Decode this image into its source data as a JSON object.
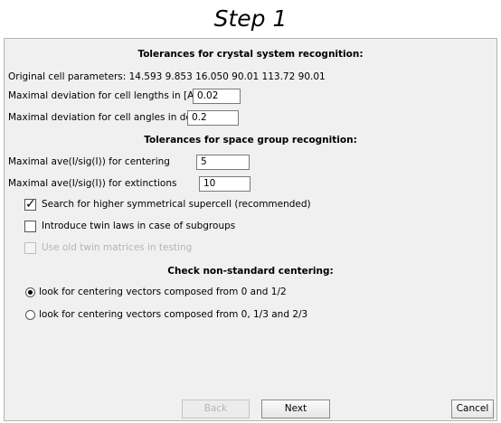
{
  "step_title": "Step 1",
  "crystal": {
    "header": "Tolerances for crystal system recognition:",
    "original_cell_label": "Original cell parameters: 14.593 9.853 16.050 90.01 113.72 90.01",
    "cell_lengths_label": "Maximal deviation for cell lengths in [A]",
    "cell_lengths_value": "0.02",
    "cell_angles_label": "Maximal deviation for cell angles in deg",
    "cell_angles_value": "0.2"
  },
  "spacegroup": {
    "header": "Tolerances for space group recognition:",
    "centering_label": "Maximal ave(I/sig(I)) for centering",
    "centering_value": "5",
    "extinctions_label": "Maximal ave(I/sig(I)) for extinctions",
    "extinctions_value": "10"
  },
  "options": {
    "supercell_label": "Search for higher symmetrical supercell (recommended)",
    "supercell_checked": true,
    "twin_laws_label": "Introduce twin laws in case of subgroups",
    "twin_laws_checked": false,
    "old_twin_label": "Use old twin matrices in testing",
    "old_twin_checked": false,
    "old_twin_enabled": false
  },
  "centering": {
    "header": "Check non-standard centering:",
    "option1_label": "look for centering vectors composed from 0 and 1/2",
    "option1_selected": true,
    "option2_label": "look for centering vectors composed from 0, 1/3 and 2/3",
    "option2_selected": false
  },
  "buttons": {
    "back_label": "Back",
    "next_label": "Next",
    "cancel_label": "Cancel"
  }
}
